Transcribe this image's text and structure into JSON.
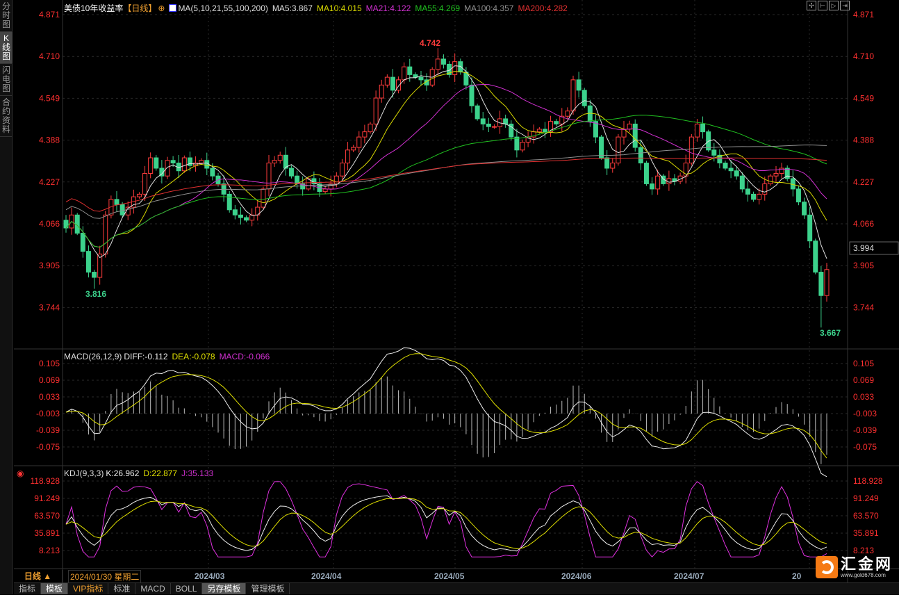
{
  "sidebar": {
    "tabs": [
      {
        "label": "分时图",
        "active": false
      },
      {
        "label": "K线图",
        "active": true
      },
      {
        "label": "闪电图",
        "active": false
      },
      {
        "label": "合约资料",
        "active": false
      }
    ]
  },
  "header": {
    "title": "美债10年收益率",
    "period": "【日线】",
    "ma_label": "MA(5,10,21,55,100,200)",
    "ma": [
      {
        "label": "MA5:3.867",
        "color": "#e0e0e0"
      },
      {
        "label": "MA10:4.015",
        "color": "#d8d800"
      },
      {
        "label": "MA21:4.122",
        "color": "#d030d0"
      },
      {
        "label": "MA55:4.269",
        "color": "#20c020"
      },
      {
        "label": "MA100:4.357",
        "color": "#909090"
      },
      {
        "label": "MA200:4.282",
        "color": "#e03030"
      }
    ]
  },
  "toolbar_icons": [
    "crosshair-icon",
    "zoom-fit-icon",
    "scroll-right-icon",
    "move-end-icon"
  ],
  "main_axis": {
    "labels": [
      "4.871",
      "4.710",
      "4.549",
      "4.388",
      "4.227",
      "4.066",
      "3.905",
      "3.744"
    ],
    "current": "3.994",
    "high_label": "4.742",
    "low_label": "3.816",
    "low2_label": "3.667"
  },
  "macd": {
    "header": "MACD(26,12,9)",
    "diff": "DIFF:-0.112",
    "dea": "DEA:-0.078",
    "macd": "MACD:-0.066",
    "labels": [
      "0.105",
      "0.069",
      "0.033",
      "-0.003",
      "-0.039",
      "-0.075"
    ]
  },
  "kdj": {
    "header": "KDJ(9,3,3)",
    "k": "K:26.962",
    "d": "D:22.877",
    "j": "J:35.133",
    "labels": [
      "118.928",
      "91.249",
      "63.570",
      "35.891",
      "8.213"
    ]
  },
  "date_axis": {
    "period": "日线 ▲",
    "cursor_date": "2024/01/30 星期二",
    "months": [
      "2024/03",
      "2024/04",
      "2024/05",
      "2024/06",
      "2024/07",
      "20"
    ]
  },
  "bottom_tabs": [
    "指标",
    "模板",
    "VIP指标",
    "标准",
    "MACD",
    "BOLL",
    "另存模板",
    "管理模板"
  ],
  "logo": {
    "name": "汇金网",
    "url": "www.gold678.com"
  },
  "colors": {
    "up": "#ff3c3c",
    "down": "#3cd28c",
    "axis_text": "#ff3030"
  },
  "chart_data": {
    "type": "candlestick",
    "closes": [
      4.05,
      4.1,
      4.03,
      3.96,
      3.88,
      3.86,
      3.95,
      4.1,
      4.16,
      4.14,
      4.1,
      4.13,
      4.17,
      4.18,
      4.26,
      4.32,
      4.28,
      4.25,
      4.31,
      4.3,
      4.27,
      4.32,
      4.29,
      4.3,
      4.31,
      4.28,
      4.25,
      4.22,
      4.18,
      4.12,
      4.1,
      4.09,
      4.08,
      4.1,
      4.13,
      4.2,
      4.3,
      4.31,
      4.33,
      4.28,
      4.25,
      4.22,
      4.2,
      4.24,
      4.22,
      4.19,
      4.2,
      4.22,
      4.25,
      4.3,
      4.35,
      4.36,
      4.4,
      4.42,
      4.45,
      4.55,
      4.6,
      4.63,
      4.58,
      4.62,
      4.67,
      4.64,
      4.63,
      4.62,
      4.6,
      4.66,
      4.7,
      4.68,
      4.64,
      4.69,
      4.65,
      4.6,
      4.52,
      4.47,
      4.45,
      4.44,
      4.44,
      4.47,
      4.45,
      4.4,
      4.35,
      4.38,
      4.4,
      4.42,
      4.43,
      4.42,
      4.46,
      4.45,
      4.48,
      4.5,
      4.62,
      4.58,
      4.52,
      4.46,
      4.4,
      4.32,
      4.28,
      4.3,
      4.4,
      4.43,
      4.45,
      4.36,
      4.3,
      4.22,
      4.2,
      4.25,
      4.22,
      4.24,
      4.23,
      4.25,
      4.3,
      4.4,
      4.45,
      4.42,
      4.35,
      4.33,
      4.3,
      4.28,
      4.27,
      4.25,
      4.2,
      4.18,
      4.16,
      4.18,
      4.22,
      4.25,
      4.26,
      4.28,
      4.24,
      4.2,
      4.15,
      4.1,
      4.0,
      3.88,
      3.79,
      3.89
    ],
    "ylim": [
      3.64,
      4.9
    ]
  }
}
